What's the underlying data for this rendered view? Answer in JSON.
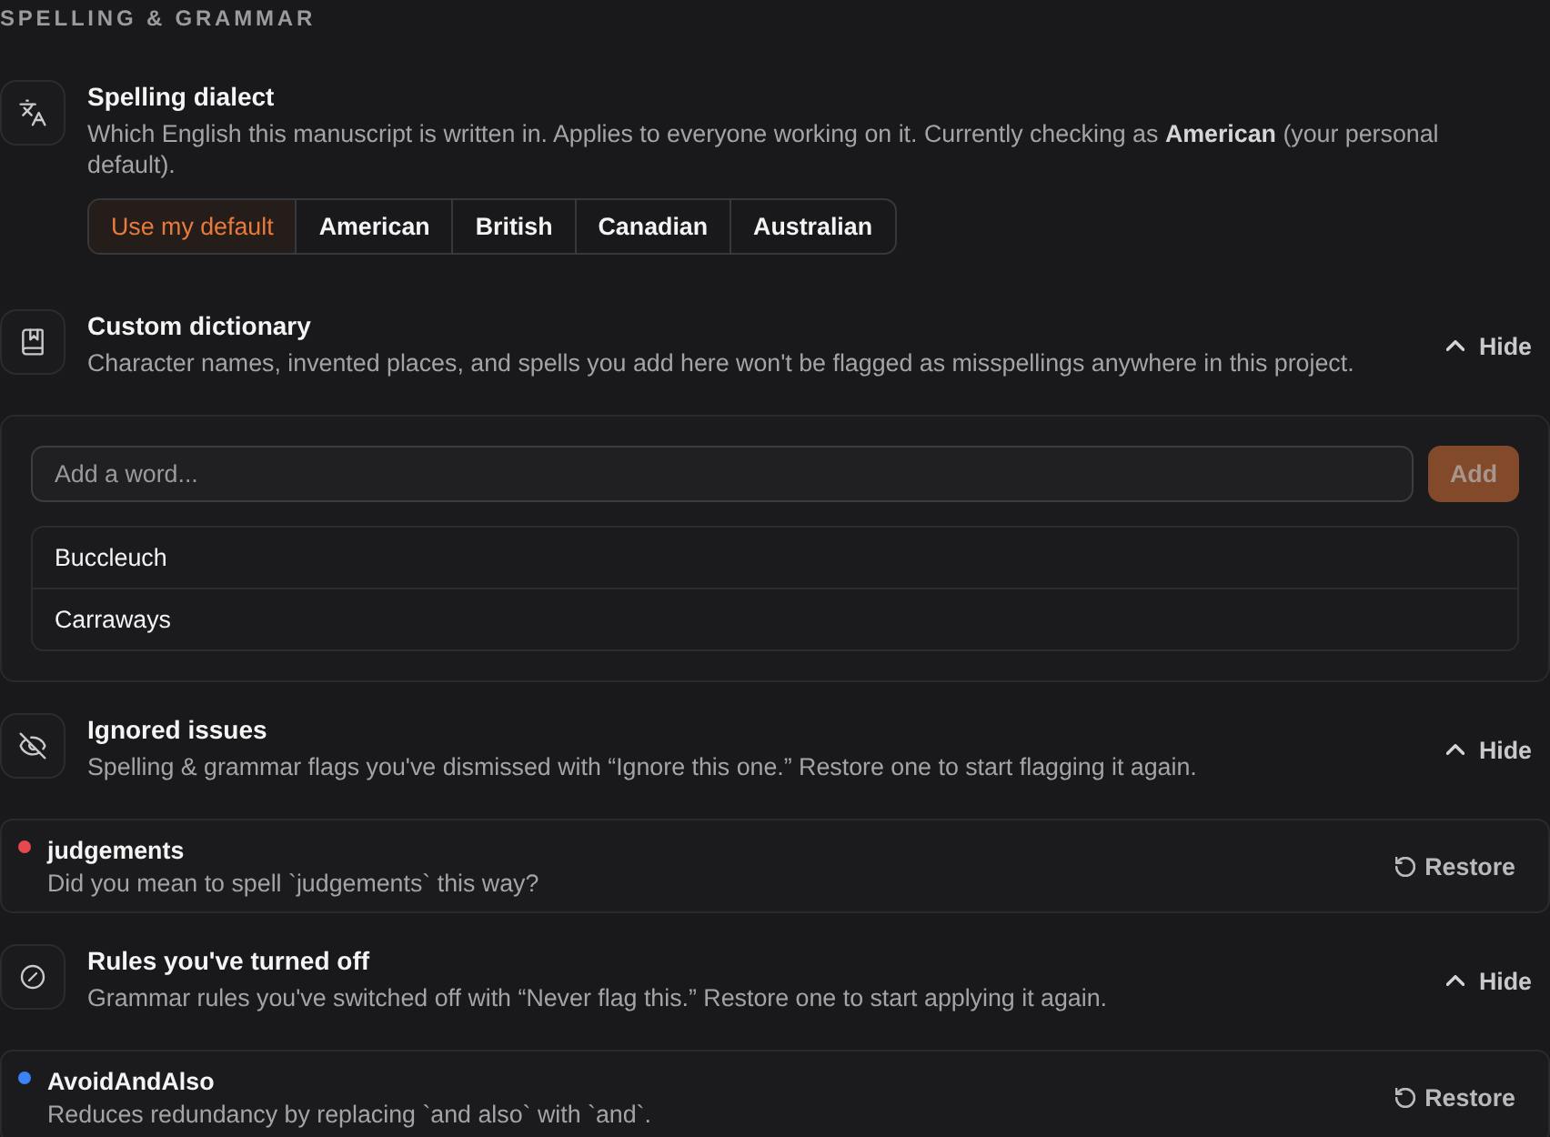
{
  "section_title": "SPELLING & GRAMMAR",
  "dialect": {
    "title": "Spelling dialect",
    "description": "Which English this manuscript is written in. Applies to everyone working on it. Currently checking as **American** (your personal default).",
    "options": [
      {
        "label": "Use my default",
        "selected": true
      },
      {
        "label": "American",
        "selected": false
      },
      {
        "label": "British",
        "selected": false
      },
      {
        "label": "Canadian",
        "selected": false
      },
      {
        "label": "Australian",
        "selected": false
      }
    ]
  },
  "dictionary": {
    "title": "Custom dictionary",
    "description": "Character names, invented places, and spells you add here won't be flagged as misspellings anywhere in this project.",
    "toggle": "Hide",
    "expanded": true,
    "input": {
      "placeholder": "Add a word..."
    },
    "add_button": {
      "label": "Add",
      "disabled": true
    },
    "words": [
      "Buccleuch",
      "Carraways"
    ]
  },
  "ignored": {
    "title": "Ignored issues",
    "description": "Spelling & grammar flags you've dismissed with “Ignore this one.” Restore one to start flagging it again.",
    "toggle": "Hide",
    "expanded": true,
    "items": [
      {
        "title": "judgements",
        "description": "Did you mean to spell `judgements` this way?",
        "color": "#e5484d",
        "action": "Restore"
      }
    ]
  },
  "rules": {
    "title": "Rules you've turned off",
    "description": "Grammar rules you've switched off with “Never flag this.” Restore one to start applying it again.",
    "toggle": "Hide",
    "expanded": true,
    "items": [
      {
        "title": "AvoidAndAlso",
        "description": "Reduces redundancy by replacing `and also` with `and`.",
        "color": "#3b82f6",
        "action": "Restore"
      }
    ]
  }
}
